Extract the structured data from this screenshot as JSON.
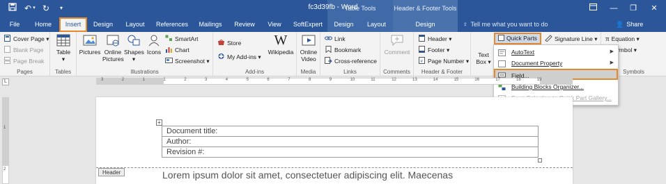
{
  "titlebar": {
    "doc_title": "fc3d39fb - Word",
    "context_table": "Table Tools",
    "context_header_footer": "Header & Footer Tools"
  },
  "tabs": {
    "file": "File",
    "home": "Home",
    "insert": "Insert",
    "design": "Design",
    "layout": "Layout",
    "references": "References",
    "mailings": "Mailings",
    "review": "Review",
    "view": "View",
    "softexpert": "SoftExpert",
    "table_design": "Design",
    "table_layout": "Layout",
    "hf_design": "Design",
    "tell_me": "Tell me what you want to do",
    "share": "Share"
  },
  "ribbon": {
    "pages": {
      "cover_page": "Cover Page",
      "blank_page": "Blank Page",
      "page_break": "Page Break",
      "label": "Pages"
    },
    "tables": {
      "table": "Table",
      "label": "Tables"
    },
    "illustrations": {
      "pictures": "Pictures",
      "online_pictures_1": "Online",
      "online_pictures_2": "Pictures",
      "shapes": "Shapes",
      "icons": "Icons",
      "smartart": "SmartArt",
      "chart": "Chart",
      "screenshot": "Screenshot",
      "label": "Illustrations"
    },
    "addins": {
      "store": "Store",
      "my_addins": "My Add-ins",
      "wikipedia": "Wikipedia",
      "label": "Add-ins"
    },
    "media": {
      "online_video_1": "Online",
      "online_video_2": "Video",
      "label": "Media"
    },
    "links": {
      "link": "Link",
      "bookmark": "Bookmark",
      "cross_reference": "Cross-reference",
      "label": "Links"
    },
    "comments": {
      "comment": "Comment",
      "label": "Comments"
    },
    "header_footer": {
      "header": "Header",
      "footer": "Footer",
      "page_number": "Page Number",
      "label": "Header & Footer"
    },
    "text": {
      "text_box_1": "Text",
      "text_box_2": "Box",
      "quick_parts": "Quick Parts",
      "signature_line": "Signature Line"
    },
    "symbols": {
      "equation": "Equation",
      "symbol": "Symbol",
      "label": "Symbols"
    }
  },
  "quick_parts_menu": {
    "autotext": "AutoText",
    "document_property": "Document Property",
    "field": "Field...",
    "building_blocks": "Building Blocks Organizer...",
    "save_selection": "Save Selection to Quick Part Gallery..."
  },
  "ruler": {
    "numbers": [
      "3",
      "2",
      "1",
      "1",
      "2",
      "3",
      "4",
      "5",
      "6",
      "7",
      "8",
      "9",
      "10",
      "11",
      "12",
      "13",
      "14",
      "15",
      "16",
      "17",
      "18",
      "19"
    ]
  },
  "vruler": {
    "numbers": [
      "1",
      "2"
    ]
  },
  "document": {
    "rows": [
      "Document title:",
      "Author:",
      "Revision #:"
    ],
    "header_tag": "Header",
    "body_text": "Lorem ipsum dolor sit amet, consectetuer adipiscing elit. Maecenas"
  },
  "colors": {
    "accent": "#2b579a",
    "highlight": "#e5892f"
  }
}
